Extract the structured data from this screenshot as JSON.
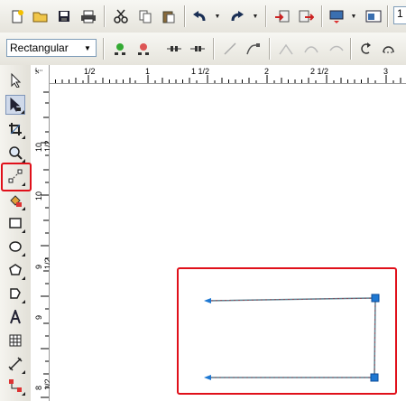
{
  "toolbar": {
    "zoom_value": "1",
    "items": [
      "new-document",
      "open",
      "save",
      "print",
      "cut",
      "copy",
      "paste",
      "undo",
      "redo",
      "import",
      "export",
      "application-launcher",
      "welcome-screen"
    ]
  },
  "property_bar": {
    "shape_mode": "Rectangular"
  },
  "rulers": {
    "horizontal": [
      "1/2",
      "1",
      "1 1/2",
      "2",
      "2 1/2",
      "3"
    ],
    "vertical": [
      "10 1/2",
      "10",
      "9 1/2",
      "9",
      "8 1/2"
    ]
  },
  "toolbox": {
    "tools": [
      "pick-tool",
      "shape-tool",
      "crop-tool",
      "zoom-tool",
      "freehand-tool",
      "smart-fill-tool",
      "rectangle-tool",
      "ellipse-tool",
      "polygon-tool",
      "basic-shapes-tool",
      "text-tool",
      "table-tool",
      "dimension-tool",
      "connector-tool"
    ],
    "highlighted": "freehand-tool"
  },
  "colors": {
    "highlight": "#e0101a",
    "node": "#1e78d2",
    "path": "#5c7f8e"
  }
}
